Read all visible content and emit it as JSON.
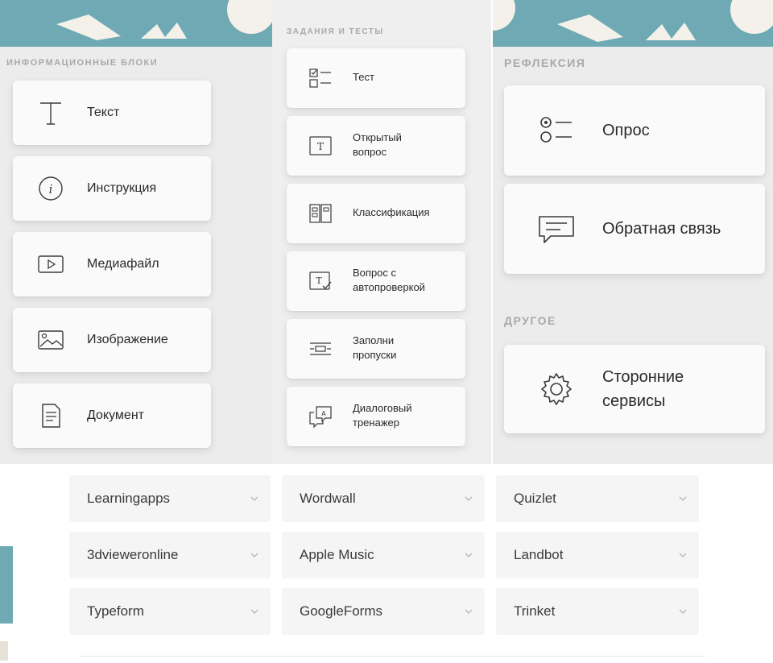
{
  "info_panel": {
    "header": "ИНФОРМАЦИОННЫЕ БЛОКИ",
    "items": [
      {
        "label": "Текст",
        "icon": "text-t-icon"
      },
      {
        "label": "Инструкция",
        "icon": "info-icon"
      },
      {
        "label": "Медиафайл",
        "icon": "media-play-icon"
      },
      {
        "label": "Изображение",
        "icon": "image-icon"
      },
      {
        "label": "Документ",
        "icon": "document-icon"
      }
    ]
  },
  "tasks_panel": {
    "header": "ЗАДАНИЯ И ТЕСТЫ",
    "items": [
      {
        "line1": "Тест",
        "line2": "",
        "icon": "checklist-icon"
      },
      {
        "line1": "Открытый",
        "line2": "вопрос",
        "icon": "text-box-icon"
      },
      {
        "line1": "Классификация",
        "line2": "",
        "icon": "columns-icon"
      },
      {
        "line1": "Вопрос с",
        "line2": "автопроверкой",
        "icon": "text-check-icon"
      },
      {
        "line1": "Заполни",
        "line2": "пропуски",
        "icon": "fill-gaps-icon"
      },
      {
        "line1": "Диалоговый",
        "line2": "тренажер",
        "icon": "dialog-icon"
      }
    ]
  },
  "reflection_panel": {
    "header": "РЕФЛЕКСИЯ",
    "items": [
      {
        "line1": "Опрос",
        "line2": "",
        "icon": "poll-icon"
      },
      {
        "line1": "Обратная связь",
        "line2": "",
        "icon": "feedback-icon"
      }
    ],
    "other_header": "ДРУГОЕ",
    "other_items": [
      {
        "line1": "Сторонние",
        "line2": "сервисы",
        "icon": "gear-icon"
      }
    ]
  },
  "services": {
    "columns": [
      [
        "Learningapps",
        "3dvieweronline",
        "Typeform"
      ],
      [
        "Wordwall",
        "Apple Music",
        "GoogleForms"
      ],
      [
        "Quizlet",
        "Landbot",
        "Trinket"
      ]
    ]
  },
  "colors": {
    "accent_teal": "#6fa9b4",
    "panel_bg": "#ececec",
    "card_bg": "#fafafa",
    "dropdown_bg": "#f5f5f6"
  }
}
